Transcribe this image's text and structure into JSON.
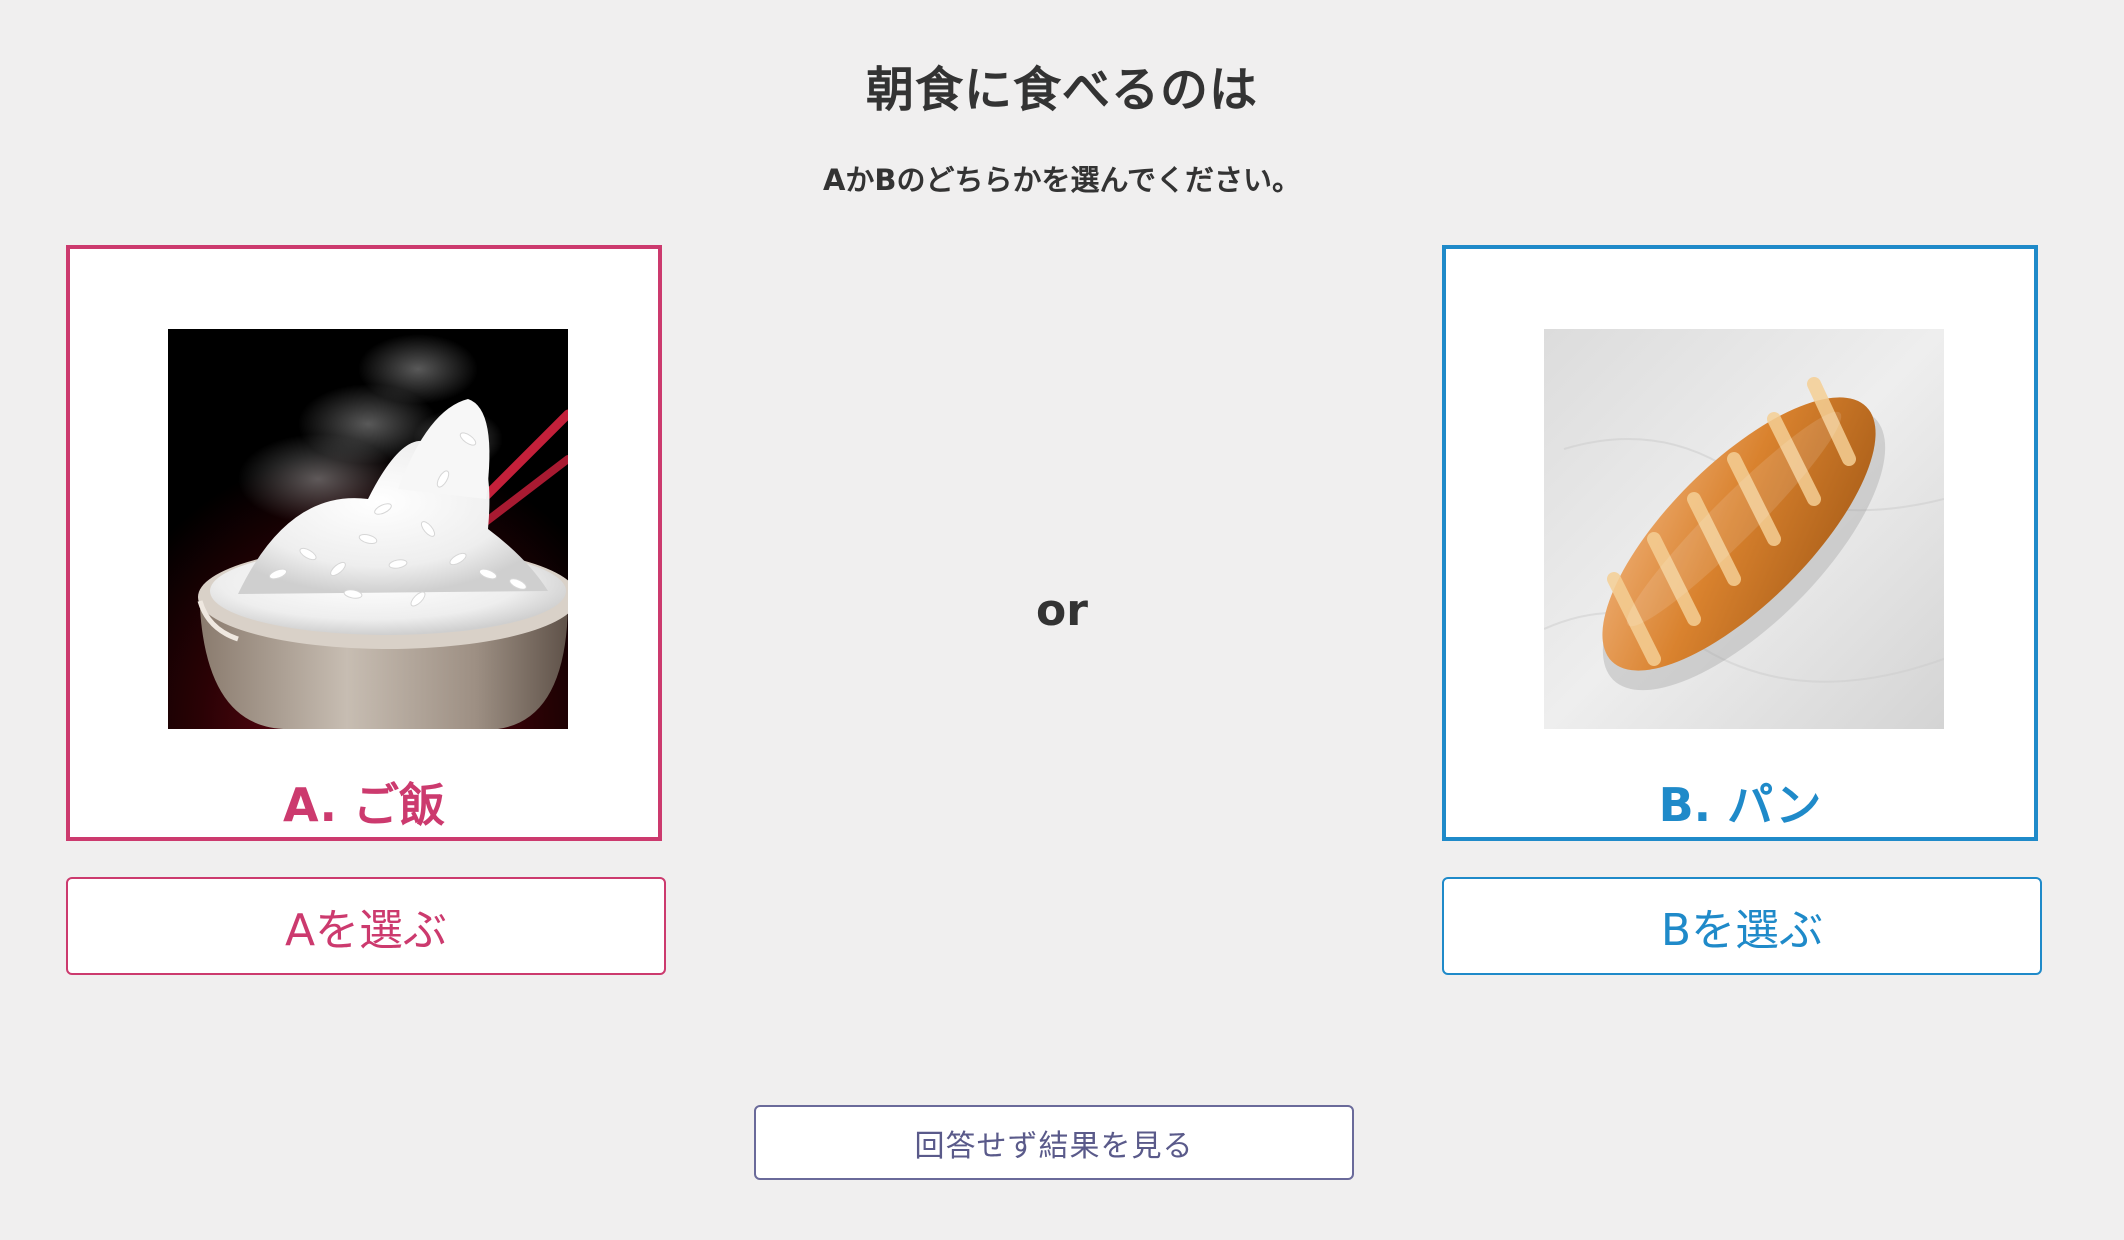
{
  "question": {
    "title": "朝食に食べるのは",
    "instruction": "AかBのどちらかを選んでください。"
  },
  "options": [
    {
      "label": "A. ご飯",
      "image": "steaming-rice-bowl",
      "button_label": "Aを選ぶ",
      "color": "#cc3a6e"
    },
    {
      "label": "B. パン",
      "image": "bread-loaf",
      "button_label": "Bを選ぶ",
      "color": "#1f8ac9"
    }
  ],
  "separator": "or",
  "skip_button_label": "回答せず結果を見る"
}
